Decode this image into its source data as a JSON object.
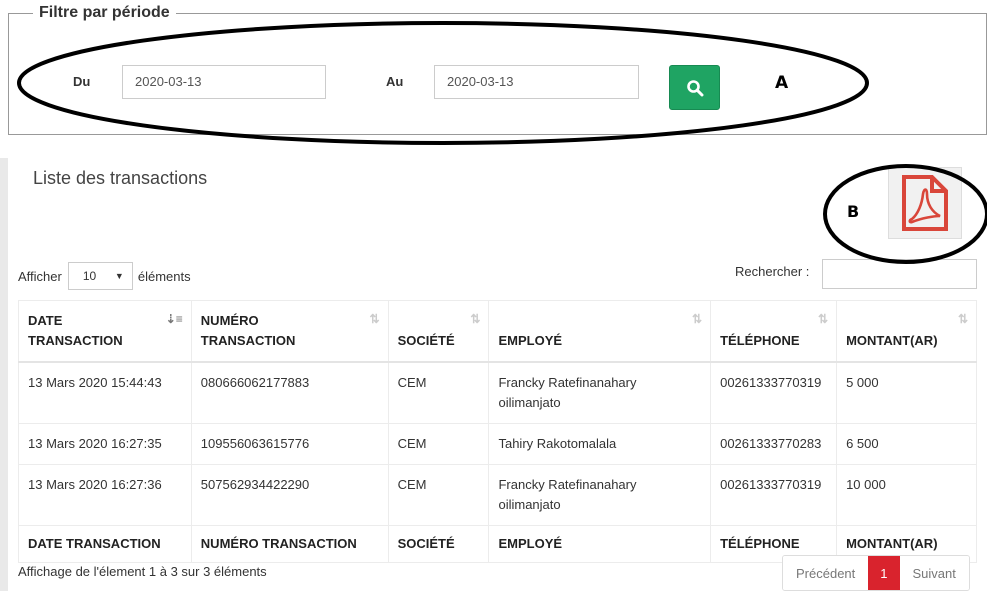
{
  "filter": {
    "legend": "Filtre par période",
    "from_label": "Du",
    "from_value": "2020-03-13",
    "to_label": "Au",
    "to_value": "2020-03-13",
    "annotation": "A"
  },
  "panel": {
    "title": "Liste des transactions",
    "annotation": "B",
    "length_prefix": "Afficher",
    "length_value": "10",
    "length_suffix": "éléments",
    "search_label": "Rechercher :"
  },
  "table": {
    "columns": [
      {
        "line1": "DATE",
        "line2": "TRANSACTION",
        "footer": "DATE TRANSACTION"
      },
      {
        "line1": "NUMÉRO",
        "line2": "TRANSACTION",
        "footer": "NUMÉRO TRANSACTION"
      },
      {
        "line1": "",
        "line2": "SOCIÉTÉ",
        "footer": "SOCIÉTÉ"
      },
      {
        "line1": "",
        "line2": "EMPLOYÉ",
        "footer": "EMPLOYÉ"
      },
      {
        "line1": "",
        "line2": "TÉLÉPHONE",
        "footer": "TÉLÉPHONE"
      },
      {
        "line1": "",
        "line2": "MONTANT(AR)",
        "footer": "MONTANT(AR)"
      }
    ],
    "rows": [
      {
        "date": "13 Mars 2020 15:44:43",
        "numero": "080666062177883",
        "societe": "CEM",
        "employe": "Francky Ratefinanahary oilimanjato",
        "telephone": "00261333770319",
        "montant": "5 000"
      },
      {
        "date": "13 Mars 2020 16:27:35",
        "numero": "109556063615776",
        "societe": "CEM",
        "employe": "Tahiry Rakotomalala",
        "telephone": "00261333770283",
        "montant": "6 500"
      },
      {
        "date": "13 Mars 2020 16:27:36",
        "numero": "507562934422290",
        "societe": "CEM",
        "employe": "Francky Ratefinanahary oilimanjato",
        "telephone": "00261333770319",
        "montant": "10 000"
      }
    ]
  },
  "footer": {
    "info": "Affichage de l'élement 1 à 3 sur 3 éléments",
    "prev": "Précédent",
    "page": "1",
    "next": "Suivant"
  },
  "colors": {
    "search_button": "#1fa463",
    "active_page": "#d9232d",
    "pdf_icon": "#d9463a"
  }
}
